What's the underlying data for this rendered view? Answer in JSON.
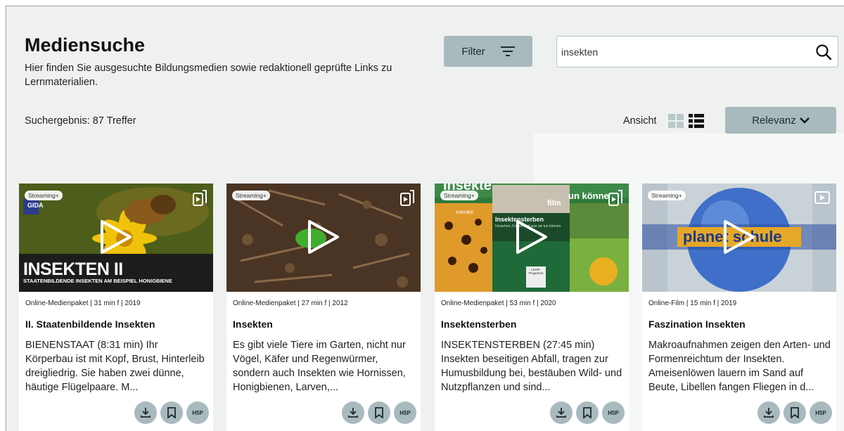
{
  "header": {
    "title": "Mediensuche",
    "description": "Hier finden Sie ausgesuchte Bildungsmedien sowie redaktionell geprüfte Links zu Lernmaterialien.",
    "filter_label": "Filter"
  },
  "search": {
    "value": "insekten",
    "icon": "search-icon"
  },
  "results": {
    "count_text": "Suchergebnis: 87 Treffer",
    "view_label": "Ansicht",
    "sort_label": "Relevanz"
  },
  "cards": [
    {
      "badge": "Streaming+",
      "meta": "Online-Medienpaket  |  31 min f  |  2019",
      "title": "II. Staatenbildende Insekten",
      "description": "BIENENSTAAT (8:31 min) Ihr Körperbau ist mit Kopf, Brust, Hinterleib dreigliedrig. Sie haben zwei dünne, häutige Flügelpaare. M...",
      "thumb_title": "INSEKTEN II",
      "thumb_subtitle": "STAATENBILDENDE INSEKTEN AM BEISPIEL HONIGBIENE",
      "thumb_logo": "GIDA",
      "type_icon": "media-package-icon"
    },
    {
      "badge": "Streaming+",
      "meta": "Online-Medienpaket  |  27 min f  |  2012",
      "title": "Insekten",
      "description": "Es gibt viele Tiere im Garten, nicht nur Vögel, Käfer und Regenwürmer, sondern auch Insekten wie Hornissen, Honigbienen, Larven,...",
      "type_icon": "media-package-icon"
    },
    {
      "badge": "Streaming+",
      "meta": "Online-Medienpaket  |  53 min f  |  2020",
      "title": "Insektensterben",
      "description": "INSEKTENSTERBEN (27:45 min) Insekten beseitigen Abfall, tragen zur Humusbildung bei, bestäuben Wild- und Nutzpflanzen und sind...",
      "thumb_top_text": "Insekte",
      "thumb_banner": "un könne",
      "thumb_film": "film",
      "thumb_box_title": "Insektensterben",
      "thumb_box_subtitle": "Ursachen, Folgen und was wir tun können",
      "thumb_interaktiv": "Interakti",
      "thumb_label": "LEHR-Programm",
      "type_icon": "media-package-icon"
    },
    {
      "badge": "Streaming+",
      "meta": "Online-Film  |  15 min f  |  2019",
      "title": "Faszination Insekten",
      "description": "Makroaufnahmen zeigen den Arten- und Formenreichtum der Insekten. Ameisenlöwen lauern im Sand auf Beute, Libellen fangen Fliegen in d...",
      "thumb_logo": "planet schule",
      "type_icon": "video-icon"
    }
  ],
  "action_labels": {
    "h5p": "H5P"
  },
  "colors": {
    "button_bg": "#a8babd",
    "page_bg": "#eff1f1"
  }
}
